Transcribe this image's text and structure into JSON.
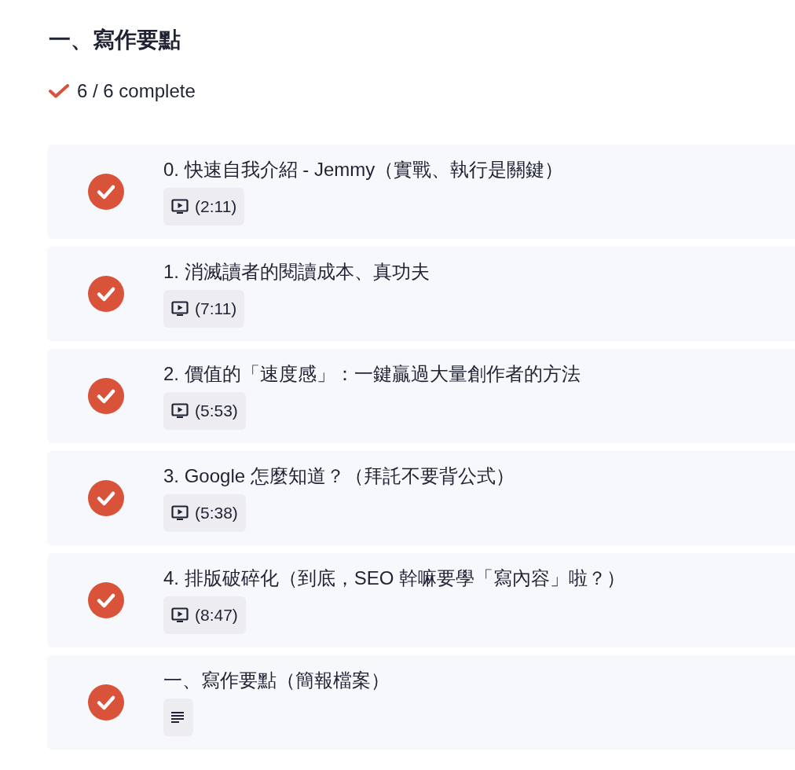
{
  "section": {
    "title": "一、寫作要點",
    "progress": "6 / 6 complete"
  },
  "lessons": [
    {
      "title": "0. 快速自我介紹 - Jemmy（實戰、執行是關鍵）",
      "kind": "video",
      "duration": "(2:11)",
      "completed": true
    },
    {
      "title": "1. 消滅讀者的閱讀成本、真功夫",
      "kind": "video",
      "duration": "(7:11)",
      "completed": true
    },
    {
      "title": "2. 價值的「速度感」：一鍵贏過大量創作者的方法",
      "kind": "video",
      "duration": "(5:53)",
      "completed": true
    },
    {
      "title": "3. Google 怎麼知道？（拜託不要背公式）",
      "kind": "video",
      "duration": "(5:38)",
      "completed": true
    },
    {
      "title": "4. 排版破碎化（到底，SEO 幹嘛要學「寫內容」啦？）",
      "kind": "video",
      "duration": "(8:47)",
      "completed": true
    },
    {
      "title": "一、寫作要點（簡報檔案）",
      "kind": "document",
      "completed": true
    }
  ]
}
